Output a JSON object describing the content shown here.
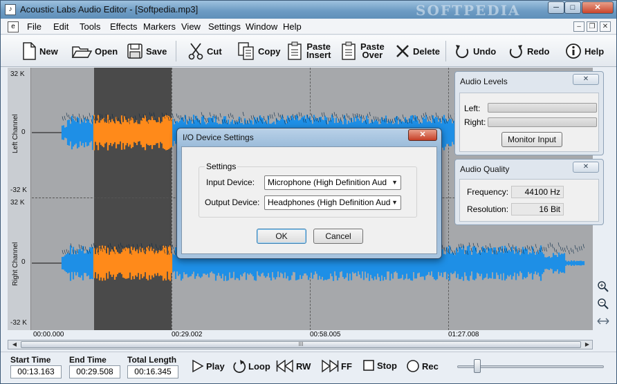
{
  "window": {
    "title": "Acoustic Labs Audio Editor - [Softpedia.mp3]",
    "watermark": "SOFTPEDIA",
    "minimize": "─",
    "maximize": "□",
    "close": "✕"
  },
  "menu": {
    "items": [
      "File",
      "Edit",
      "Tools",
      "Effects",
      "Markers",
      "View",
      "Settings",
      "Window",
      "Help"
    ],
    "mdi_minimize": "–",
    "mdi_restore": "❐",
    "mdi_close": "✕"
  },
  "toolbar": {
    "new": "New",
    "open": "Open",
    "save": "Save",
    "cut": "Cut",
    "copy": "Copy",
    "paste_insert_1": "Paste",
    "paste_insert_2": "Insert",
    "paste_over_1": "Paste",
    "paste_over_2": "Over",
    "delete": "Delete",
    "undo": "Undo",
    "redo": "Redo",
    "help": "Help"
  },
  "editor": {
    "left_channel": "Left Channel",
    "right_channel": "Right Channel",
    "ticks": [
      "32 K",
      "0",
      "-32 K",
      "32 K",
      "0",
      "-32 K"
    ],
    "times": [
      "00:00.000",
      "00:29.002",
      "00:58.005",
      "01:27.008"
    ],
    "wave_color": "#1e8fe6",
    "selection_color": "#ff8a1a",
    "scroll_thumb_grip": "III"
  },
  "audio_levels": {
    "title": "Audio Levels",
    "close": "✕",
    "left_label": "Left:",
    "right_label": "Right:",
    "monitor_button": "Monitor Input"
  },
  "audio_quality": {
    "title": "Audio Quality",
    "close": "✕",
    "frequency_label": "Frequency:",
    "frequency_value": "44100 Hz",
    "resolution_label": "Resolution:",
    "resolution_value": "16 Bit"
  },
  "dialog": {
    "title": "I/O Device Settings",
    "close": "✕",
    "group_label": "Settings",
    "input_label": "Input Device:",
    "input_value": "Microphone (High Definition Aud",
    "output_label": "Output Device:",
    "output_value": "Headphones (High Definition Aud",
    "ok": "OK",
    "cancel": "Cancel"
  },
  "transport": {
    "start_label": "Start Time",
    "start_value": "00:13.163",
    "end_label": "End Time",
    "end_value": "00:29.508",
    "length_label": "Total Length",
    "length_value": "00:16.345",
    "play": "Play",
    "loop": "Loop",
    "rw": "RW",
    "ff": "FF",
    "stop": "Stop",
    "rec": "Rec"
  }
}
